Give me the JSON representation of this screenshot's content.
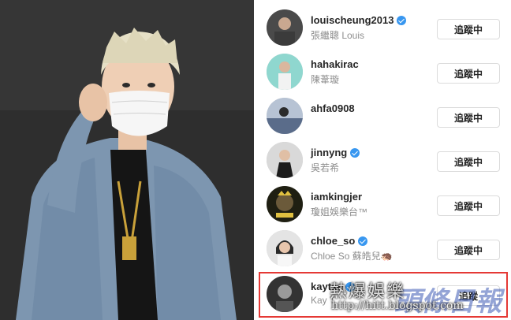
{
  "follow_list": [
    {
      "username": "louischeung2013",
      "full_name": "張繼聰 Louis",
      "verified": true,
      "button_label": "追蹤中",
      "avatar_icon": "profile-photo-avatar",
      "avatar_color": "#4a4a4a"
    },
    {
      "username": "hahakirac",
      "full_name": "陳葦璇",
      "verified": false,
      "button_label": "追蹤中",
      "avatar_icon": "profile-photo-avatar",
      "avatar_color": "#7fd0c8"
    },
    {
      "username": "ahfa0908",
      "full_name": "",
      "verified": false,
      "button_label": "追蹤中",
      "avatar_icon": "profile-photo-avatar",
      "avatar_color": "#5a6c8a"
    },
    {
      "username": "jinnyng",
      "full_name": "吳若希",
      "verified": true,
      "button_label": "追蹤中",
      "avatar_icon": "profile-photo-avatar",
      "avatar_color": "#c9c9c9"
    },
    {
      "username": "iamkingjer",
      "full_name": "瓊姐娛樂台™",
      "verified": false,
      "button_label": "追蹤中",
      "avatar_icon": "profile-photo-avatar",
      "avatar_color": "#2a2a1a"
    },
    {
      "username": "chloe_so",
      "full_name": "Chloe So 蘇皓兒🦔",
      "verified": true,
      "button_label": "追蹤中",
      "avatar_icon": "profile-photo-avatar",
      "avatar_color": "#d8d8d8"
    },
    {
      "username": "kaytse",
      "full_name": "Kay T",
      "verified": true,
      "button_label": "追蹤",
      "avatar_icon": "profile-photo-avatar",
      "avatar_color": "#333333"
    }
  ],
  "watermark": {
    "site_name": "熱爆娛樂",
    "url": "http://hitt.blogspot.com",
    "overlay_text": "頭條日報"
  },
  "colors": {
    "highlight_border": "#e53935",
    "verified_badge": "#3897f0"
  }
}
